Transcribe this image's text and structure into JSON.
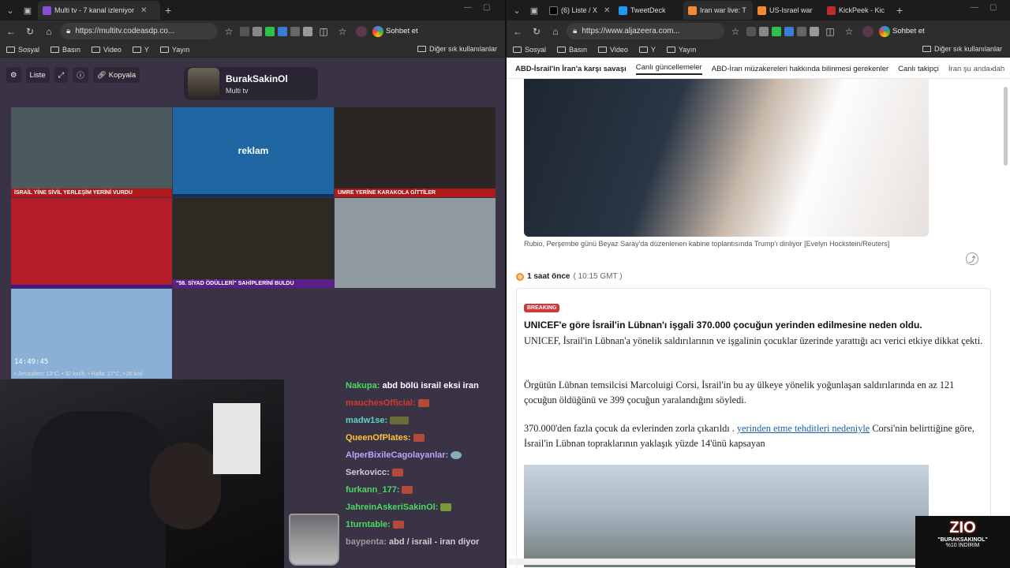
{
  "left_window": {
    "tab": {
      "title": "Multi tv - 7 kanal izleniyor",
      "favicon_color": "#8a4dd8"
    },
    "url": "https://multitv.codeasdp.co...",
    "chat_button": "Sohbet et",
    "bookmarks": [
      "Sosyal",
      "Basın",
      "Video",
      "Y",
      "Yayın"
    ],
    "other_bookmarks": "Diğer sık kullanılanlar",
    "toolbar": {
      "list_label": "Liste",
      "copy_label": "Kopyala"
    },
    "channel": {
      "name": "BurakSakinOl",
      "subtitle": "Multi tv"
    },
    "videos": [
      {
        "caption": "İSRAİL YİNE SİVİL YERLEŞİM YERİNİ VURDU",
        "bg": "#4a5a5e",
        "bar": "#b01919"
      },
      {
        "caption": "reklam",
        "bg": "#1f66a3",
        "bar": "#0d2f5a"
      },
      {
        "caption": "UMRE YERİNE KARAKOLA GİTTİLER",
        "bg": "#2a2624",
        "bar": "#b01919"
      },
      {
        "caption": "",
        "bg": "#b41c2a",
        "bar": "#3a1a8a"
      },
      {
        "caption": "\"58. SİYAD ÖDÜLLERİ\" SAHİPLERİNİ BULDU",
        "bg": "#2c2a22",
        "bar": "#5b1f8a"
      },
      {
        "caption": "",
        "bg": "#8f9aa0",
        "bar": "transparent"
      },
      {
        "caption": "",
        "bg": "#8ab0d8",
        "bar": "transparent"
      }
    ],
    "weather_clock": "14:49:45",
    "weather_text": "• Jerusalem: 13°C, • 32 km/h,    • Haifa: 17°C, • 26 km/",
    "chat": [
      {
        "user": "Nakupa:",
        "text": "abd bölü israil eksi iran",
        "color": "#ffffff"
      },
      {
        "user": "mauchesOfficial:",
        "text": "",
        "color": "#d33a2f"
      },
      {
        "user": "madw1se:",
        "text": "",
        "color": "#5fd3c4"
      },
      {
        "user": "QueenOfPlates:",
        "text": "",
        "color": "#ffc23a"
      },
      {
        "user": "AlperBixileCagolayanlar:",
        "text": "",
        "color": "#b8a6ff"
      },
      {
        "user": "Serkovicc:",
        "text": "",
        "color": "#cfcfcf"
      },
      {
        "user": "furkann_177:",
        "text": "",
        "color": "#4cd964"
      },
      {
        "user": "JahreinAskeriSakinOl:",
        "text": "",
        "color": "#4cd964"
      },
      {
        "user": "1turntable:",
        "text": "",
        "color": "#4cd964"
      },
      {
        "user": "baypenta:",
        "text": "abd / israil - iran diyor",
        "color": "#9b9b9b"
      }
    ]
  },
  "right_window": {
    "tabs": [
      {
        "title": "(6) Liste / X",
        "favicon_color": "#000000"
      },
      {
        "title": "TweetDeck",
        "favicon_color": "#1d9bf0"
      },
      {
        "title": "Iran war live: T",
        "favicon_color": "#f28b2f"
      },
      {
        "title": "US-Israel war",
        "favicon_color": "#f28b2f"
      },
      {
        "title": "KickPeek - Kic",
        "favicon_color": "#c02a2a"
      }
    ],
    "url": "https://www.aljazeera.com...",
    "chat_button": "Sohbet et",
    "bookmarks": [
      "Sosyal",
      "Basın",
      "Video",
      "Y",
      "Yayın"
    ],
    "other_bookmarks": "Diğer sık kullanılanlar",
    "topic_nav": {
      "bold": "ABD-İsrail'in İran'a karşı savaşı",
      "items": [
        "Canlı güncellemeler",
        "ABD-İran müzakereleri hakkında bilinmesi gerekenler",
        "Canlı takipçi",
        "İran şu anda dah"
      ]
    },
    "image_caption": "Rubio, Perşembe günü Beyaz Saray'da düzenlenen kabine toplantısında Trump'ı dinliyor [Evelyn Hockstein/Reuters]",
    "time_ago": "1 saat önce",
    "time_gmt": "( 10:15 GMT )",
    "badge": "BREAKING",
    "headline": "UNICEF'e göre İsrail'in Lübnan'ı işgali 370.000 çocuğun yerinden edilmesine neden oldu.",
    "para1": "UNICEF, İsrail'in Lübnan'a yönelik saldırılarının ve işgalinin çocuklar üzerinde yarattığı acı verici etkiye dikkat çekti.",
    "para2": "Örgütün Lübnan temsilcisi Marcoluigi Corsi, İsrail'in bu ay ülkeye yönelik yoğunlaşan saldırılarında en az 121 çocuğun öldüğünü ve 399 çocuğun yaralandığını söyledi.",
    "para3_start": "370.000'den fazla çocuk da evlerinden zorla çıkarıldı .",
    "para3_link": "yerinden etme tehditleri nedeniyle",
    "para3_end": "Corsi'nin belirttiğine göre, İsrail'in Lübnan topraklarının yaklaşık yüzde 14'ünü kapsayan"
  },
  "promo": {
    "logo": "ZIO",
    "line1": "\"BURAKSAKINOL\"",
    "line2": "%10 İNDİRİM"
  }
}
